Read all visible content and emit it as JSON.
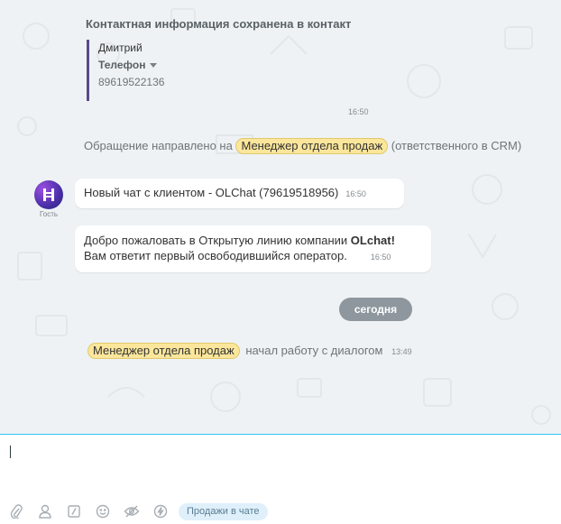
{
  "contact_saved": {
    "title": "Контактная информация сохранена в контакт",
    "name": "Дмитрий",
    "phone_label": "Телефон",
    "phone_value": "89619522136",
    "time": "16:50"
  },
  "routing": {
    "prefix": "Обращение направлено на",
    "queue": "Менеджер отдела продаж",
    "suffix": "(ответственного в CRM)"
  },
  "guest": {
    "avatar_label": "Гость"
  },
  "messages": [
    {
      "text": "Новый чат с клиентом - OLChat (79619518956)",
      "time": "16:50"
    },
    {
      "line1": "Добро пожаловать в Открытую линию компании ",
      "brand": "OLchat!",
      "line2": "Вам ответит первый освободившийся оператор.",
      "time": "16:50"
    }
  ],
  "date_divider": "сегодня",
  "operator_event": {
    "queue": "Менеджер отдела продаж",
    "text": "начал работу с диалогом",
    "time": "13:49"
  },
  "composer": {
    "toolbar_icons": [
      "paperclip-icon",
      "user-icon",
      "slash-icon",
      "smile-icon",
      "hide-icon",
      "lightning-icon"
    ],
    "sales_chip": "Продажи в чате",
    "accent": "#2fc6f6"
  }
}
